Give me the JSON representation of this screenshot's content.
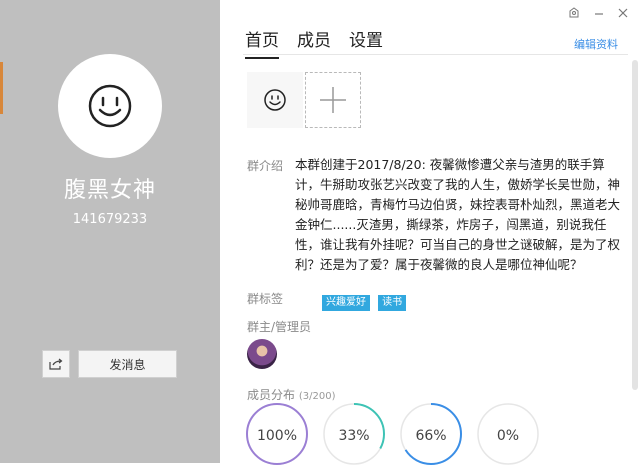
{
  "profile": {
    "name": "腹黑女神",
    "id": "141679233",
    "message_button": "发消息"
  },
  "tabs": [
    "首页",
    "成员",
    "设置"
  ],
  "edit_link": "编辑资料",
  "sections": {
    "intro_label": "群介绍",
    "intro_text": "本群创建于2017/8/20: 夜馨微惨遭父亲与渣男的联手算计，牛掰助攻张艺兴改变了我的人生，傲娇学长吴世勋，神秘帅哥鹿晗，青梅竹马边伯贤，妹控表哥朴灿烈，黑道老大金钟仁......灭渣男，撕绿茶，炸房子，闯黑道，别说我任性，谁让我有外挂呢？可当自己的身世之谜破解，是为了权利？还是为了爱？属于夜馨微的良人是哪位神仙呢？",
    "tags_label": "群标签",
    "tags": [
      "兴趣爱好",
      "读书"
    ],
    "admin_label": "群主/管理员",
    "distribution_label": "成员分布",
    "distribution_count": "(3/200)"
  },
  "distribution": [
    {
      "label": "100%",
      "value": 1.0,
      "color": "#9b7fd4"
    },
    {
      "label": "33%",
      "value": 0.33,
      "color": "#3ec3b5"
    },
    {
      "label": "66%",
      "value": 0.66,
      "color": "#3a8ee6"
    },
    {
      "label": "0%",
      "value": 0.0,
      "color": "#cccccc"
    }
  ],
  "colors": {
    "left_panel": "#bfbfbf",
    "accent": "#3a8ee6",
    "tag": "#31a8df"
  }
}
